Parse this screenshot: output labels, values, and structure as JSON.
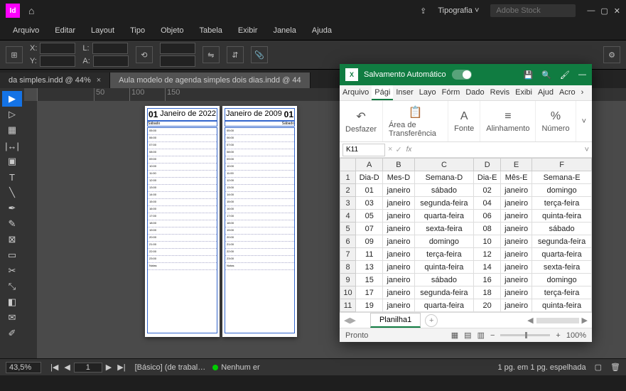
{
  "indesign": {
    "logo": "Id",
    "workspace_label": "Tipografia",
    "search_placeholder": "Adobe Stock",
    "menu": [
      "Arquivo",
      "Editar",
      "Layout",
      "Tipo",
      "Objeto",
      "Tabela",
      "Exibir",
      "Janela",
      "Ajuda"
    ],
    "control": {
      "X_label": "X:",
      "Y_label": "Y:",
      "L_label": "L:",
      "A_label": "A:"
    },
    "tabs": [
      {
        "label": "da simples.indd @ 44%",
        "active": false
      },
      {
        "label": "Aula modelo de agenda simples dois dias.indd @ 44",
        "active": true
      }
    ],
    "ruler_marks": [
      "50",
      "100",
      "150"
    ],
    "left_page": {
      "month": "Janeiro de 2022",
      "day": "01",
      "weekday": "Sábado"
    },
    "right_page": {
      "month": "Janeiro de 2009",
      "day": "01",
      "weekday": "Sábado"
    },
    "hours": [
      "05:00",
      "06:00",
      "07:00",
      "08:00",
      "09:00",
      "10:00",
      "11:00",
      "12:00",
      "13:00",
      "14:00",
      "15:00",
      "16:00",
      "17:00",
      "18:00",
      "19:00",
      "20:00",
      "21:00",
      "22:00",
      "23:00",
      "Notas"
    ],
    "status": {
      "zoom": "43,5%",
      "page": "1",
      "style": "[Básico] (de trabal…",
      "preflight": "Nenhum er",
      "spread": "1 pg. em 1 pg. espelhada"
    }
  },
  "excel": {
    "autosave_label": "Salvamento Automático",
    "tabs": [
      "Arquivo",
      "Pági",
      "Inser",
      "Layo",
      "Fórm",
      "Dado",
      "Revis",
      "Exibi",
      "Ajud",
      "Acro"
    ],
    "active_tab": 1,
    "ribbon_groups": [
      {
        "label": "Desfazer",
        "drop": true
      },
      {
        "label": "Área de Transferência",
        "drop": true
      },
      {
        "label": "Fonte",
        "drop": true
      },
      {
        "label": "Alinhamento",
        "drop": true
      },
      {
        "label": "Número",
        "drop": true
      }
    ],
    "name_box": "K11",
    "headers": [
      "",
      "A",
      "B",
      "C",
      "D",
      "E",
      "F"
    ],
    "col_labels": [
      "Dia-D",
      "Mes-D",
      "Semana-D",
      "Dia-E",
      "Mês-E",
      "Semana-E"
    ],
    "rows": [
      [
        "01",
        "janeiro",
        "sábado",
        "02",
        "janeiro",
        "domingo"
      ],
      [
        "03",
        "janeiro",
        "segunda-feira",
        "04",
        "janeiro",
        "terça-feira"
      ],
      [
        "05",
        "janeiro",
        "quarta-feira",
        "06",
        "janeiro",
        "quinta-feira"
      ],
      [
        "07",
        "janeiro",
        "sexta-feira",
        "08",
        "janeiro",
        "sábado"
      ],
      [
        "09",
        "janeiro",
        "domingo",
        "10",
        "janeiro",
        "segunda-feira"
      ],
      [
        "11",
        "janeiro",
        "terça-feira",
        "12",
        "janeiro",
        "quarta-feira"
      ],
      [
        "13",
        "janeiro",
        "quinta-feira",
        "14",
        "janeiro",
        "sexta-feira"
      ],
      [
        "15",
        "janeiro",
        "sábado",
        "16",
        "janeiro",
        "domingo"
      ],
      [
        "17",
        "janeiro",
        "segunda-feira",
        "18",
        "janeiro",
        "terça-feira"
      ],
      [
        "19",
        "janeiro",
        "quarta-feira",
        "20",
        "janeiro",
        "quinta-feira"
      ]
    ],
    "sheet_name": "Planilha1",
    "status": {
      "ready": "Pronto",
      "zoom": "100%"
    }
  }
}
